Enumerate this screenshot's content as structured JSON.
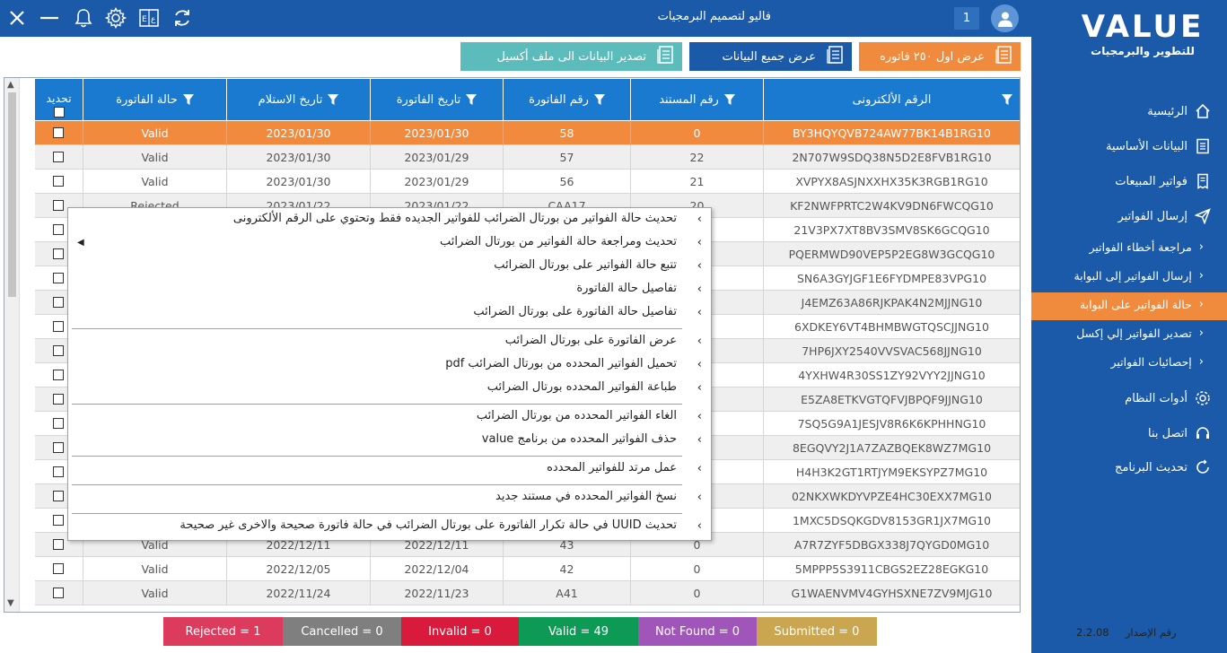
{
  "brand": {
    "logo": "VALUE",
    "subtitle": "للتطوير والبرمجيات"
  },
  "topbar": {
    "user_name": "فاليو لتصميم البرمجيات",
    "user_count": "1",
    "icons": [
      "close-icon",
      "minimize-icon",
      "bell-icon",
      "gear-icon",
      "language-icon",
      "refresh-icon"
    ]
  },
  "nav": [
    {
      "label": "الرئيسية",
      "icon": "home-icon"
    },
    {
      "label": "البيانات الأساسية",
      "icon": "document-icon"
    },
    {
      "label": "فواتير المبيعات",
      "icon": "invoice-icon"
    },
    {
      "label": "إرسال الفواتير",
      "icon": "send-icon"
    },
    {
      "label": "مراجعة أخطاء الفواتير",
      "sub": true
    },
    {
      "label": "إرسال الفواتير إلى البوابة",
      "sub": true
    },
    {
      "label": "حالة الفواتير على البوابة",
      "sub": true,
      "active": true
    },
    {
      "label": "تصدير الفواتير إلي إكسل",
      "sub": true
    },
    {
      "label": "إحصائيات الفواتير",
      "sub": true
    },
    {
      "label": "أدوات النظام",
      "icon": "gear-icon"
    },
    {
      "label": "اتصل بنا",
      "icon": "headset-icon"
    },
    {
      "label": "تحديث البرنامج",
      "icon": "update-icon"
    }
  ],
  "version": {
    "label": "رقم الإصدار",
    "value": "2.2.08"
  },
  "actions": {
    "first_250": "عرض اول ٢٥٠ فاتوره",
    "show_all": "عرض جميع البيانات",
    "export_excel": "تصدير البيانات الى ملف أكسيل"
  },
  "table": {
    "headers": {
      "electronic_id": "الرقم الألكترونى",
      "doc_no": "رقم المستند",
      "invoice_no": "رقم الفاتورة",
      "invoice_date": "تاريخ الفاتورة",
      "receive_date": "تاريخ الاستلام",
      "status": "حالة الفاتورة",
      "select": "تحديد"
    },
    "rows": [
      {
        "electronic_id": "BY3HQYQVB724AW77BK14B1RG10",
        "doc_no": "0",
        "invoice_no": "58",
        "invoice_date": "2023/01/30",
        "receive_date": "2023/01/30",
        "status": "Valid"
      },
      {
        "electronic_id": "2N707W9SDQ38N5D2E8FVB1RG10",
        "doc_no": "22",
        "invoice_no": "57",
        "invoice_date": "2023/01/29",
        "receive_date": "2023/01/30",
        "status": "Valid"
      },
      {
        "electronic_id": "XVPYX8ASJNXXHX35K3RGB1RG10",
        "doc_no": "21",
        "invoice_no": "56",
        "invoice_date": "2023/01/29",
        "receive_date": "2023/01/30",
        "status": "Valid"
      },
      {
        "electronic_id": "KF2NWFPRTC2W4KV9DN6FWCQG10",
        "doc_no": "20",
        "invoice_no": "CAA17",
        "invoice_date": "2023/01/22",
        "receive_date": "2023/01/22",
        "status": "Rejected"
      },
      {
        "electronic_id": "21V3PX7XT8BV3SMV8SK6GCQG10",
        "doc_no": "",
        "invoice_no": "",
        "invoice_date": "",
        "receive_date": "",
        "status": ""
      },
      {
        "electronic_id": "PQERMWD90VEP5P2EG8W3GCQG10",
        "doc_no": "",
        "invoice_no": "",
        "invoice_date": "",
        "receive_date": "",
        "status": ""
      },
      {
        "electronic_id": "SN6A3GYJGF1E6FYDMPE83VPG10",
        "doc_no": "",
        "invoice_no": "",
        "invoice_date": "",
        "receive_date": "",
        "status": ""
      },
      {
        "electronic_id": "J4EMZ63A86RJKPAK4N2MJJNG10",
        "doc_no": "",
        "invoice_no": "",
        "invoice_date": "",
        "receive_date": "",
        "status": ""
      },
      {
        "electronic_id": "6XDKEY6VT4BHMBWGTQSCJJNG10",
        "doc_no": "",
        "invoice_no": "",
        "invoice_date": "",
        "receive_date": "",
        "status": ""
      },
      {
        "electronic_id": "7HP6JXY2540VVSVAC568JJNG10",
        "doc_no": "",
        "invoice_no": "",
        "invoice_date": "",
        "receive_date": "",
        "status": ""
      },
      {
        "electronic_id": "4YXHW4R30SS1ZY92VYY2JJNG10",
        "doc_no": "",
        "invoice_no": "",
        "invoice_date": "",
        "receive_date": "",
        "status": ""
      },
      {
        "electronic_id": "E5ZA8ETKVGTQFVJBPQF9JJNG10",
        "doc_no": "",
        "invoice_no": "",
        "invoice_date": "",
        "receive_date": "",
        "status": ""
      },
      {
        "electronic_id": "7SQ5G9A1JESJV8R6K6KPHHNG10",
        "doc_no": "",
        "invoice_no": "",
        "invoice_date": "",
        "receive_date": "",
        "status": ""
      },
      {
        "electronic_id": "8EGQVY2J1A7ZAZBQEK8WZ7MG10",
        "doc_no": "",
        "invoice_no": "",
        "invoice_date": "",
        "receive_date": "",
        "status": ""
      },
      {
        "electronic_id": "H4H3K2GT1RTJYM9EKSYPZ7MG10",
        "doc_no": "",
        "invoice_no": "",
        "invoice_date": "",
        "receive_date": "",
        "status": ""
      },
      {
        "electronic_id": "02NKXWKDYVPZE4HC30EXX7MG10",
        "doc_no": "",
        "invoice_no": "",
        "invoice_date": "",
        "receive_date": "",
        "status": ""
      },
      {
        "electronic_id": "1MXC5DSQKGDV8153GR1JX7MG10",
        "doc_no": "",
        "invoice_no": "",
        "invoice_date": "",
        "receive_date": "",
        "status": ""
      },
      {
        "electronic_id": "A7R7ZYF5DBGX338J7QYGD0MG10",
        "doc_no": "0",
        "invoice_no": "43",
        "invoice_date": "2022/12/11",
        "receive_date": "2022/12/11",
        "status": "Valid"
      },
      {
        "electronic_id": "5MPPP5S3911CBGS2EZ28EGKG10",
        "doc_no": "0",
        "invoice_no": "42",
        "invoice_date": "2022/12/04",
        "receive_date": "2022/12/05",
        "status": "Valid"
      },
      {
        "electronic_id": "G1WAENVMV4GYHSXNE7ZV9MJG10",
        "doc_no": "0",
        "invoice_no": "A41",
        "invoice_date": "2022/11/23",
        "receive_date": "2022/11/24",
        "status": "Valid"
      }
    ]
  },
  "context_menu": {
    "items": [
      "تحديث حالة الفواتير من بورتال الضرائب للفواتير الجديده فقط وتحتوي على الرقم الألكترونى",
      "تحديث ومراجعة حالة الفواتير من بورتال الضرائب",
      "تتبع حالة الفواتير على بورتال الضرائب",
      "تفاصيل حالة الفاتورة",
      "تفاصيل حالة الفاتورة على بورتال الضرائب",
      "عرض الفاتورة على بورتال الضرائب",
      "تحميل الفواتير المحدده من بورتال الضرائب pdf",
      "طباعة الفواتير المحدده بورتال الضرائب",
      "الغاء الفواتير المحدده من بورتال الضرائب",
      "حذف الفواتير المحدده من برنامج value",
      "عمل مرتد للفواتير المحدده",
      "نسخ الفواتير المحدده في مستند جديد",
      "تحديث UUID في حالة تكرار الفاتورة على بورتال الضرائب في حالة فاتورة صحيحة والاخرى غير صحيحة"
    ]
  },
  "status_bar": {
    "rejected": "Rejected = 1",
    "cancelled": "Cancelled = 0",
    "invalid": "Invalid = 0",
    "valid": "Valid = 49",
    "not_found": "Not Found = 0",
    "submitted": "Submitted = 0"
  },
  "colors": {
    "primary": "#1a5aa8",
    "header": "#1a7ad0",
    "selected_row": "#f18a3d",
    "rejected": "#dc3b5e",
    "cancelled": "#7f7f7f",
    "invalid": "#d81b3c",
    "valid": "#0c9a55",
    "not_found": "#a056b9",
    "submitted": "#c9a64f"
  }
}
